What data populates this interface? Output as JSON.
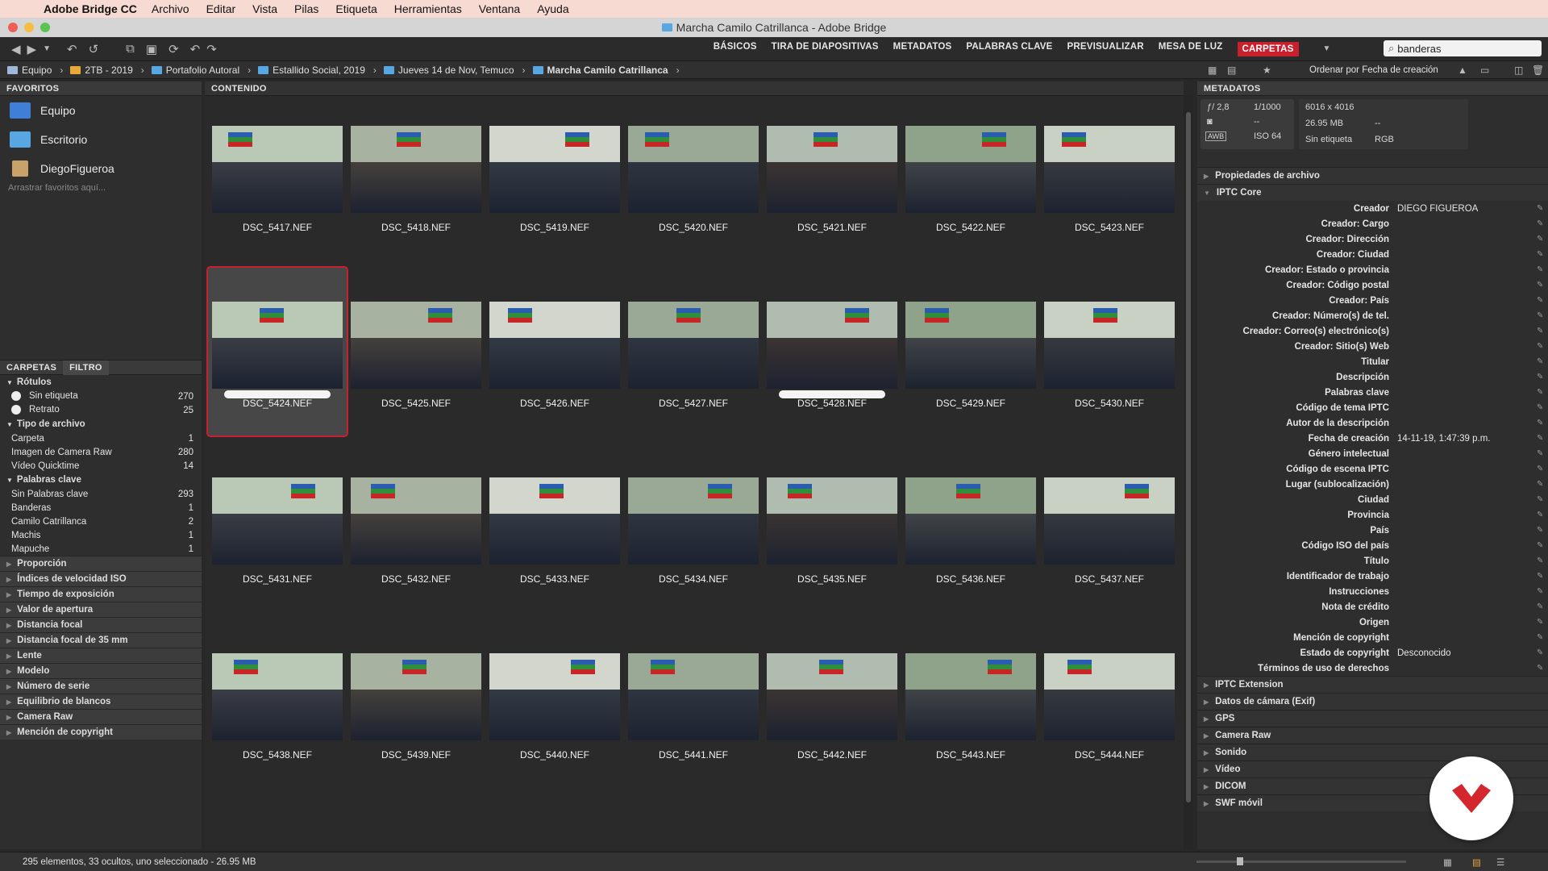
{
  "menubar": {
    "app": "Adobe Bridge CC",
    "items": [
      "Archivo",
      "Editar",
      "Vista",
      "Pilas",
      "Etiqueta",
      "Herramientas",
      "Ventana",
      "Ayuda"
    ]
  },
  "window": {
    "title": "Marcha Camilo Catrillanca - Adobe Bridge"
  },
  "workspaces": [
    {
      "label": "BÁSICOS",
      "active": false
    },
    {
      "label": "TIRA DE DIAPOSITIVAS",
      "active": false
    },
    {
      "label": "METADATOS",
      "active": false
    },
    {
      "label": "PALABRAS CLAVE",
      "active": false
    },
    {
      "label": "PREVISUALIZAR",
      "active": false
    },
    {
      "label": "MESA DE LUZ",
      "active": false
    },
    {
      "label": "CARPETAS",
      "active": true
    }
  ],
  "search": {
    "value": "banderas"
  },
  "path": [
    "Equipo",
    "2TB - 2019",
    "Portafolio Autoral",
    "Estallido Social, 2019",
    "Jueves 14 de Nov, Temuco",
    "Marcha Camilo Catrillanca"
  ],
  "sort_label": "Ordenar por Fecha de creación",
  "favorites": {
    "title": "FAVORITOS",
    "items": [
      "Equipo",
      "Escritorio",
      "DiegoFigueroa"
    ],
    "hint": "Arrastrar favoritos aquí..."
  },
  "filter": {
    "tabs": [
      "CARPETAS",
      "FILTRO"
    ],
    "groups": [
      {
        "name": "Rótulos",
        "rows": [
          {
            "label": "Sin etiqueta",
            "count": "270"
          },
          {
            "label": "Retrato",
            "count": "25"
          }
        ]
      },
      {
        "name": "Tipo de archivo",
        "rows": [
          {
            "label": "Carpeta",
            "count": "1"
          },
          {
            "label": "Imagen de Camera Raw",
            "count": "280"
          },
          {
            "label": "Vídeo Quicktime",
            "count": "14"
          }
        ]
      },
      {
        "name": "Palabras clave",
        "rows": [
          {
            "label": "Sin Palabras clave",
            "count": "293"
          },
          {
            "label": "Banderas",
            "count": "1"
          },
          {
            "label": "Camilo Catrillanca",
            "count": "2"
          },
          {
            "label": "Machis",
            "count": "1"
          },
          {
            "label": "Mapuche",
            "count": "1"
          }
        ]
      }
    ],
    "collapsed": [
      "Proporción",
      "Índices de velocidad ISO",
      "Tiempo de exposición",
      "Valor de apertura",
      "Distancia focal",
      "Distancia focal de 35 mm",
      "Lente",
      "Modelo",
      "Número de serie",
      "Equilibrio de blancos",
      "Camera Raw",
      "Mención de copyright"
    ]
  },
  "content": {
    "title": "CONTENIDO"
  },
  "thumbnails": [
    {
      "name": "DSC_5417.NEF",
      "selected": false,
      "pill": false
    },
    {
      "name": "DSC_5418.NEF",
      "selected": false,
      "pill": false
    },
    {
      "name": "DSC_5419.NEF",
      "selected": false,
      "pill": false
    },
    {
      "name": "DSC_5420.NEF",
      "selected": false,
      "pill": false
    },
    {
      "name": "DSC_5421.NEF",
      "selected": false,
      "pill": false
    },
    {
      "name": "DSC_5422.NEF",
      "selected": false,
      "pill": false
    },
    {
      "name": "DSC_5423.NEF",
      "selected": false,
      "pill": false
    },
    {
      "name": "DSC_5424.NEF",
      "selected": true,
      "pill": true
    },
    {
      "name": "DSC_5425.NEF",
      "selected": false,
      "pill": false
    },
    {
      "name": "DSC_5426.NEF",
      "selected": false,
      "pill": false
    },
    {
      "name": "DSC_5427.NEF",
      "selected": false,
      "pill": false
    },
    {
      "name": "DSC_5428.NEF",
      "selected": false,
      "pill": true
    },
    {
      "name": "DSC_5429.NEF",
      "selected": false,
      "pill": false
    },
    {
      "name": "DSC_5430.NEF",
      "selected": false,
      "pill": false
    },
    {
      "name": "DSC_5431.NEF",
      "selected": false,
      "pill": false
    },
    {
      "name": "DSC_5432.NEF",
      "selected": false,
      "pill": false
    },
    {
      "name": "DSC_5433.NEF",
      "selected": false,
      "pill": false
    },
    {
      "name": "DSC_5434.NEF",
      "selected": false,
      "pill": false
    },
    {
      "name": "DSC_5435.NEF",
      "selected": false,
      "pill": false
    },
    {
      "name": "DSC_5436.NEF",
      "selected": false,
      "pill": false
    },
    {
      "name": "DSC_5437.NEF",
      "selected": false,
      "pill": false
    },
    {
      "name": "DSC_5438.NEF",
      "selected": false,
      "pill": false
    },
    {
      "name": "DSC_5439.NEF",
      "selected": false,
      "pill": false
    },
    {
      "name": "DSC_5440.NEF",
      "selected": false,
      "pill": false
    },
    {
      "name": "DSC_5441.NEF",
      "selected": false,
      "pill": false
    },
    {
      "name": "DSC_5442.NEF",
      "selected": false,
      "pill": false
    },
    {
      "name": "DSC_5443.NEF",
      "selected": false,
      "pill": false
    },
    {
      "name": "DSC_5444.NEF",
      "selected": false,
      "pill": false
    }
  ],
  "metadata": {
    "title": "METADATOS",
    "camera": {
      "aperture": "2,8",
      "shutter": "1/1000",
      "meter": "--",
      "iso": "64",
      "dims": "6016 x 4016",
      "size": "26.95 MB",
      "size_extra": "--",
      "label": "Sin etiqueta",
      "color": "RGB"
    },
    "sections_top": [
      "Propiedades de archivo",
      "IPTC Core"
    ],
    "fields": [
      {
        "k": "Creador",
        "v": "DIEGO FIGUEROA"
      },
      {
        "k": "Creador: Cargo",
        "v": ""
      },
      {
        "k": "Creador: Dirección",
        "v": ""
      },
      {
        "k": "Creador: Ciudad",
        "v": ""
      },
      {
        "k": "Creador: Estado o provincia",
        "v": ""
      },
      {
        "k": "Creador: Código postal",
        "v": ""
      },
      {
        "k": "Creador: País",
        "v": ""
      },
      {
        "k": "Creador: Número(s) de tel.",
        "v": ""
      },
      {
        "k": "Creador: Correo(s) electrónico(s)",
        "v": ""
      },
      {
        "k": "Creador: Sitio(s) Web",
        "v": ""
      },
      {
        "k": "Titular",
        "v": ""
      },
      {
        "k": "Descripción",
        "v": ""
      },
      {
        "k": "Palabras clave",
        "v": ""
      },
      {
        "k": "Código de tema IPTC",
        "v": ""
      },
      {
        "k": "Autor de la descripción",
        "v": ""
      },
      {
        "k": "Fecha de creación",
        "v": "14-11-19, 1:47:39 p.m."
      },
      {
        "k": "Género intelectual",
        "v": ""
      },
      {
        "k": "Código de escena IPTC",
        "v": ""
      },
      {
        "k": "Lugar (sublocalización)",
        "v": ""
      },
      {
        "k": "Ciudad",
        "v": ""
      },
      {
        "k": "Provincia",
        "v": ""
      },
      {
        "k": "País",
        "v": ""
      },
      {
        "k": "Código ISO del país",
        "v": ""
      },
      {
        "k": "Título",
        "v": ""
      },
      {
        "k": "Identificador de trabajo",
        "v": ""
      },
      {
        "k": "Instrucciones",
        "v": ""
      },
      {
        "k": "Nota de crédito",
        "v": ""
      },
      {
        "k": "Origen",
        "v": ""
      },
      {
        "k": "Mención de copyright",
        "v": ""
      },
      {
        "k": "Estado de copyright",
        "v": "Desconocido"
      },
      {
        "k": "Términos de uso de derechos",
        "v": ""
      }
    ],
    "sections_bottom": [
      "IPTC Extension",
      "Datos de cámara (Exif)",
      "GPS",
      "Camera Raw",
      "Sonido",
      "Vídeo",
      "DICOM",
      "SWF móvil"
    ]
  },
  "status": "295 elementos, 33 ocultos, uno seleccionado - 26.95 MB"
}
